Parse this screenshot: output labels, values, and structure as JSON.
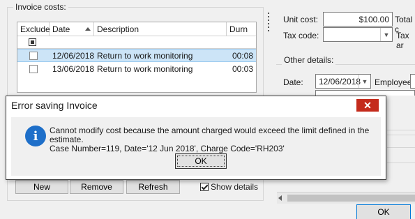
{
  "invoice_costs": {
    "title": "Invoice costs:",
    "columns": [
      "Exclude",
      "Date",
      "Description",
      "Durn"
    ],
    "rows": [
      {
        "date": "12/06/2018",
        "description": "Return to work monitoring",
        "durn": "00:08",
        "selected": true
      },
      {
        "date": "13/06/2018",
        "description": "Return to work monitoring",
        "durn": "00:03",
        "selected": false
      }
    ],
    "buttons": {
      "new": "New",
      "remove": "Remove",
      "refresh": "Refresh"
    },
    "show_details_label": "Show details",
    "show_details_checked": true
  },
  "cost_panel": {
    "unit_cost_label": "Unit cost:",
    "unit_cost_value": "$100.00",
    "total_label": "Total c",
    "tax_code_label": "Tax code:",
    "tax_code_value": "",
    "tax_amount_label": "Tax ar"
  },
  "other_details": {
    "title": "Other details:",
    "date_label": "Date:",
    "date_value": "12/06/2018",
    "employee_label": "Employee:"
  },
  "main_ok_label": "OK",
  "dialog": {
    "title": "Error saving Invoice",
    "close_glyph": "✕",
    "icon_glyph": "i",
    "message_line1": "Cannot modify cost because the amount charged would exceed the limit defined in the estimate.",
    "message_line2": "Case Number=119, Date='12 Jun 2018', Charge Code='RH203'",
    "ok_label": "OK"
  }
}
